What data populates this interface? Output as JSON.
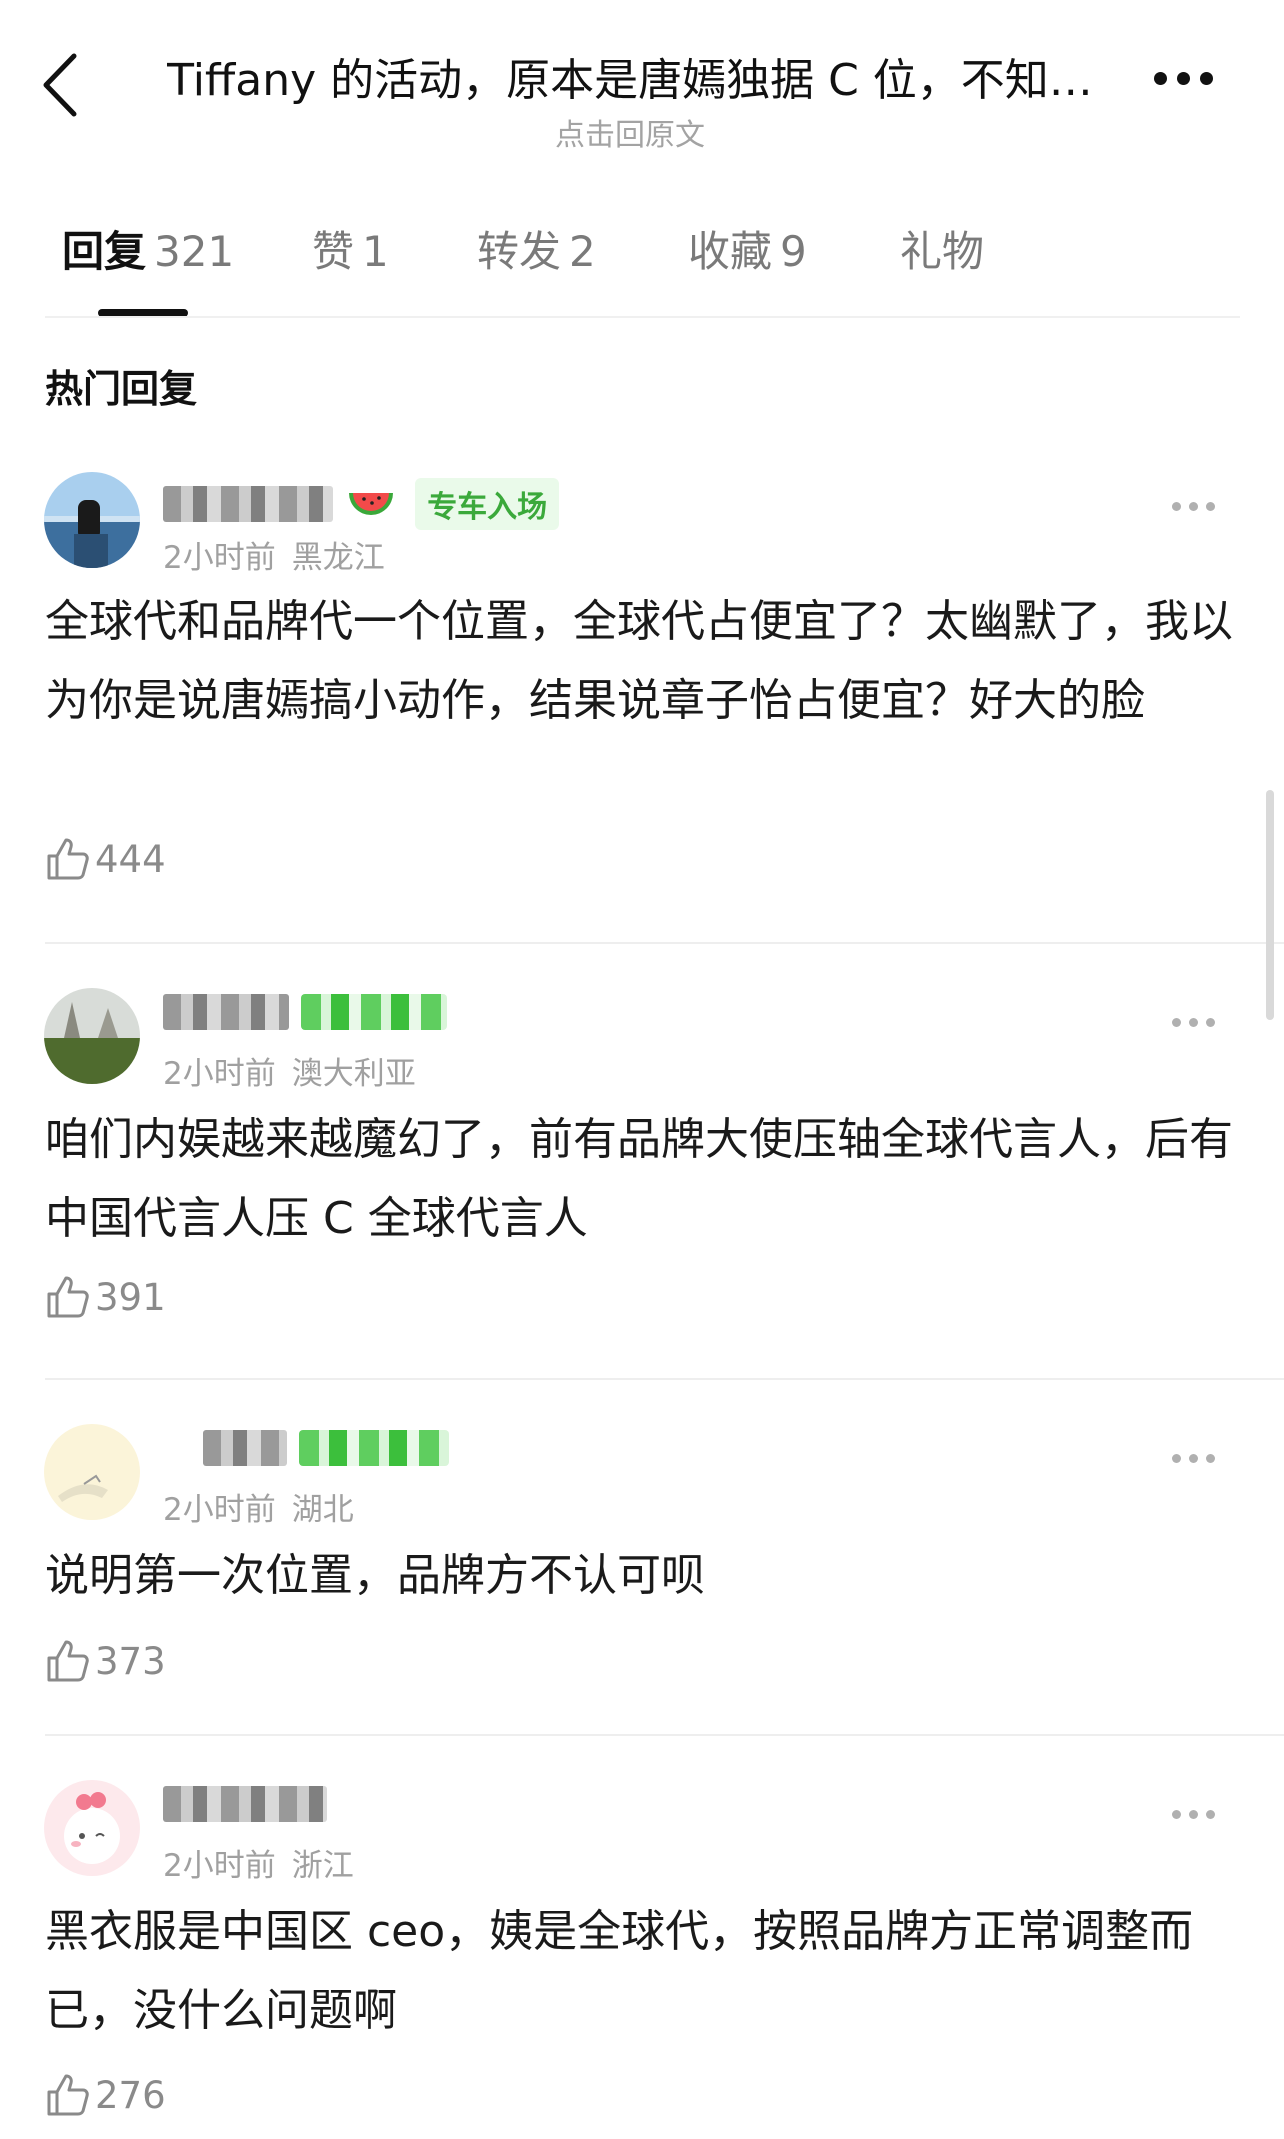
{
  "header": {
    "title": "Tiffany 的活动，原本是唐嫣独据 C 位，不知…",
    "subtitle": "点击回原文"
  },
  "tabs": [
    {
      "label": "回复",
      "count": "321"
    },
    {
      "label": "赞",
      "count": "1"
    },
    {
      "label": "转发",
      "count": "2"
    },
    {
      "label": "收藏",
      "count": "9"
    },
    {
      "label": "礼物",
      "count": ""
    }
  ],
  "section_title": "热门回复",
  "comments": [
    {
      "badge": "专车入场",
      "time": "2小时前",
      "region": "黑龙江",
      "text": "全球代和品牌代一个位置，全球代占便宜了？太幽默了，我以为你是说唐嫣搞小动作，结果说章子怡占便宜？好大的脸",
      "likes": "444"
    },
    {
      "time": "2小时前",
      "region": "澳大利亚",
      "text": "咱们内娱越来越魔幻了，前有品牌大使压轴全球代言人，后有中国代言人压 C 全球代言人",
      "likes": "391"
    },
    {
      "time": "2小时前",
      "region": "湖北",
      "text": "说明第一次位置，品牌方不认可呗",
      "likes": "373"
    },
    {
      "time": "2小时前",
      "region": "浙江",
      "text": "黑衣服是中国区 ceo，姨是全球代，按照品牌方正常调整而已，没什么问题啊",
      "likes": "276"
    }
  ]
}
